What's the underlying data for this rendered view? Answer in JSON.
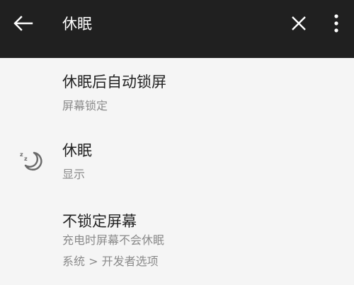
{
  "toolbar": {
    "search_query": "休眠",
    "icons": {
      "back": "arrow-back-icon",
      "clear": "close-icon",
      "more": "more-vert-icon"
    },
    "background_color": "#202020"
  },
  "results": [
    {
      "title": "休眠后自动锁屏",
      "summary": "屏幕锁定",
      "icon": null
    },
    {
      "title": "休眠",
      "summary": "显示",
      "icon": "sleep-moon-icon"
    },
    {
      "title": "不锁定屏幕",
      "summary_lines": [
        "充电时屏幕不会休眠",
        "系统 > 开发者选项"
      ],
      "icon": null
    }
  ]
}
